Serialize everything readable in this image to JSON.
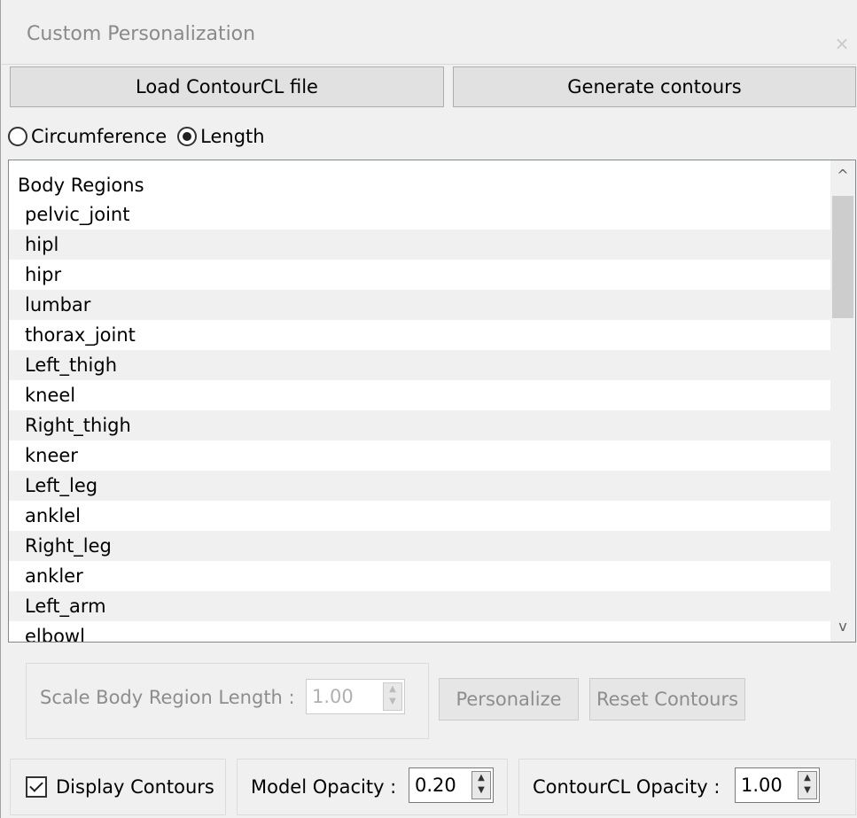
{
  "window": {
    "title": "Custom Personalization",
    "close_glyph": "×"
  },
  "toolbar": {
    "load_label": "Load ContourCL file",
    "generate_label": "Generate contours"
  },
  "mode": {
    "options": [
      {
        "label": "Circumference",
        "checked": false
      },
      {
        "label": "Length",
        "checked": true
      }
    ]
  },
  "body_regions": {
    "header": "Body Regions",
    "items": [
      "pelvic_joint",
      "hipl",
      "hipr",
      "lumbar",
      "thorax_joint",
      "Left_thigh",
      "kneel",
      "Right_thigh",
      "kneer",
      "Left_leg",
      "anklel",
      "Right_leg",
      "ankler",
      "Left_arm",
      "elbowl"
    ],
    "scroll_up_glyph": "^",
    "scroll_down_glyph": "v"
  },
  "scale": {
    "label": "Scale Body Region Length :",
    "value": "1.00",
    "personalize_label": "Personalize",
    "reset_label": "Reset Contours"
  },
  "footer": {
    "display_contours_label": "Display Contours",
    "display_contours_checked": true,
    "model_opacity_label": "Model Opacity :",
    "model_opacity_value": "0.20",
    "contourcl_opacity_label": "ContourCL Opacity :",
    "contourcl_opacity_value": "1.00"
  },
  "colors": {
    "background": "#f0f0f0",
    "list_alt_row": "#f0f0f0",
    "disabled_text": "#8d8d8d"
  }
}
